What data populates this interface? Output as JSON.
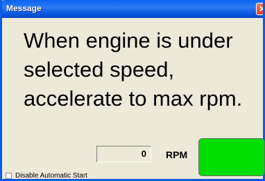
{
  "window": {
    "title": "Message",
    "close_glyph": "✕"
  },
  "message": {
    "text": "When engine is under selected speed, accelerate to max rpm."
  },
  "rpm": {
    "value": "0",
    "unit_label": "RPM",
    "status_color": "#00dd00"
  },
  "options": {
    "disable_automatic_start": {
      "label": "Disable Automatic Start",
      "checked": false
    }
  },
  "colors": {
    "titlebar": "#0a5be5",
    "window_background": "#ece9d8"
  }
}
